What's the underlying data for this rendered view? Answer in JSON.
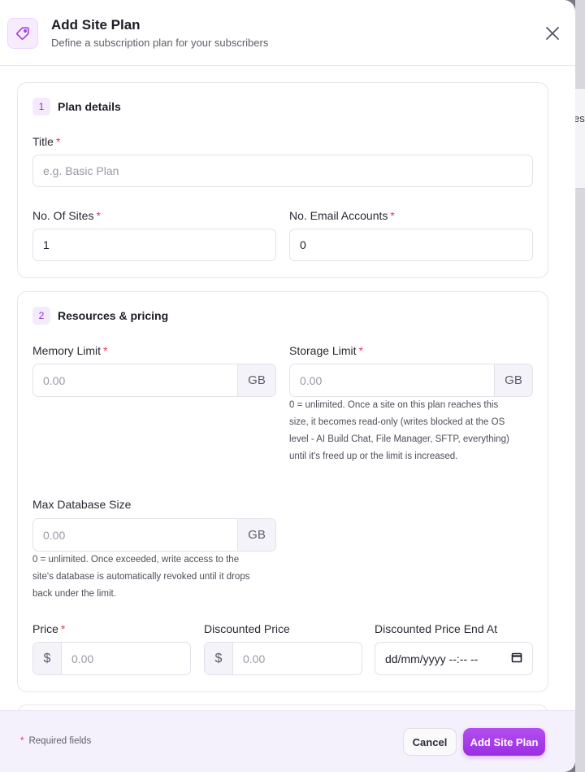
{
  "background": {
    "peek_text": "es"
  },
  "modal": {
    "title": "Add Site Plan",
    "subtitle": "Define a subscription plan for your subscribers",
    "header_icon": "tag-icon",
    "close_icon": "close-icon"
  },
  "sections": {
    "plan_details": {
      "number": "1",
      "title": "Plan details",
      "title_field": {
        "label": "Title",
        "required_mark": "*",
        "placeholder": "e.g. Basic Plan"
      },
      "sites_field": {
        "label": "No. Of Sites",
        "required_mark": "*",
        "value": "1"
      },
      "email_field": {
        "label": "No. Email Accounts",
        "required_mark": "*",
        "value": "0"
      }
    },
    "resources": {
      "number": "2",
      "title": "Resources & pricing",
      "memory": {
        "label": "Memory Limit",
        "required_mark": "*",
        "placeholder": "0.00",
        "unit": "GB"
      },
      "storage": {
        "label": "Storage Limit",
        "required_mark": "*",
        "placeholder": "0.00",
        "unit": "GB",
        "help": [
          "0 = unlimited. Once a site on this plan reaches this",
          "size, it becomes read-only (writes blocked at the OS",
          "level - AI Build Chat, File Manager, SFTP, everything)",
          "until it's freed up or the limit is increased."
        ]
      },
      "database": {
        "label": "Max Database Size",
        "placeholder": "0.00",
        "unit": "GB",
        "help": [
          "0 = unlimited. Once exceeded, write access to the",
          "site's database is automatically revoked until it drops",
          "back under the limit."
        ]
      },
      "price": {
        "label": "Price",
        "required_mark": "*",
        "prefix": "$",
        "placeholder": "0.00"
      },
      "discounted_price": {
        "label": "Discounted Price",
        "prefix": "$",
        "placeholder": "0.00"
      },
      "discount_end": {
        "label": "Discounted Price End At",
        "value": "dd/mm/yyyy --:-- --",
        "icon": "calendar-icon"
      }
    }
  },
  "footer": {
    "required_note_mark": "*",
    "required_note": "Required fields",
    "cancel_label": "Cancel",
    "submit_label": "Add Site Plan"
  },
  "colors": {
    "accent": "#9b2ee2",
    "required": "#e23b5a",
    "footer_bg": "#f5f1fc"
  }
}
